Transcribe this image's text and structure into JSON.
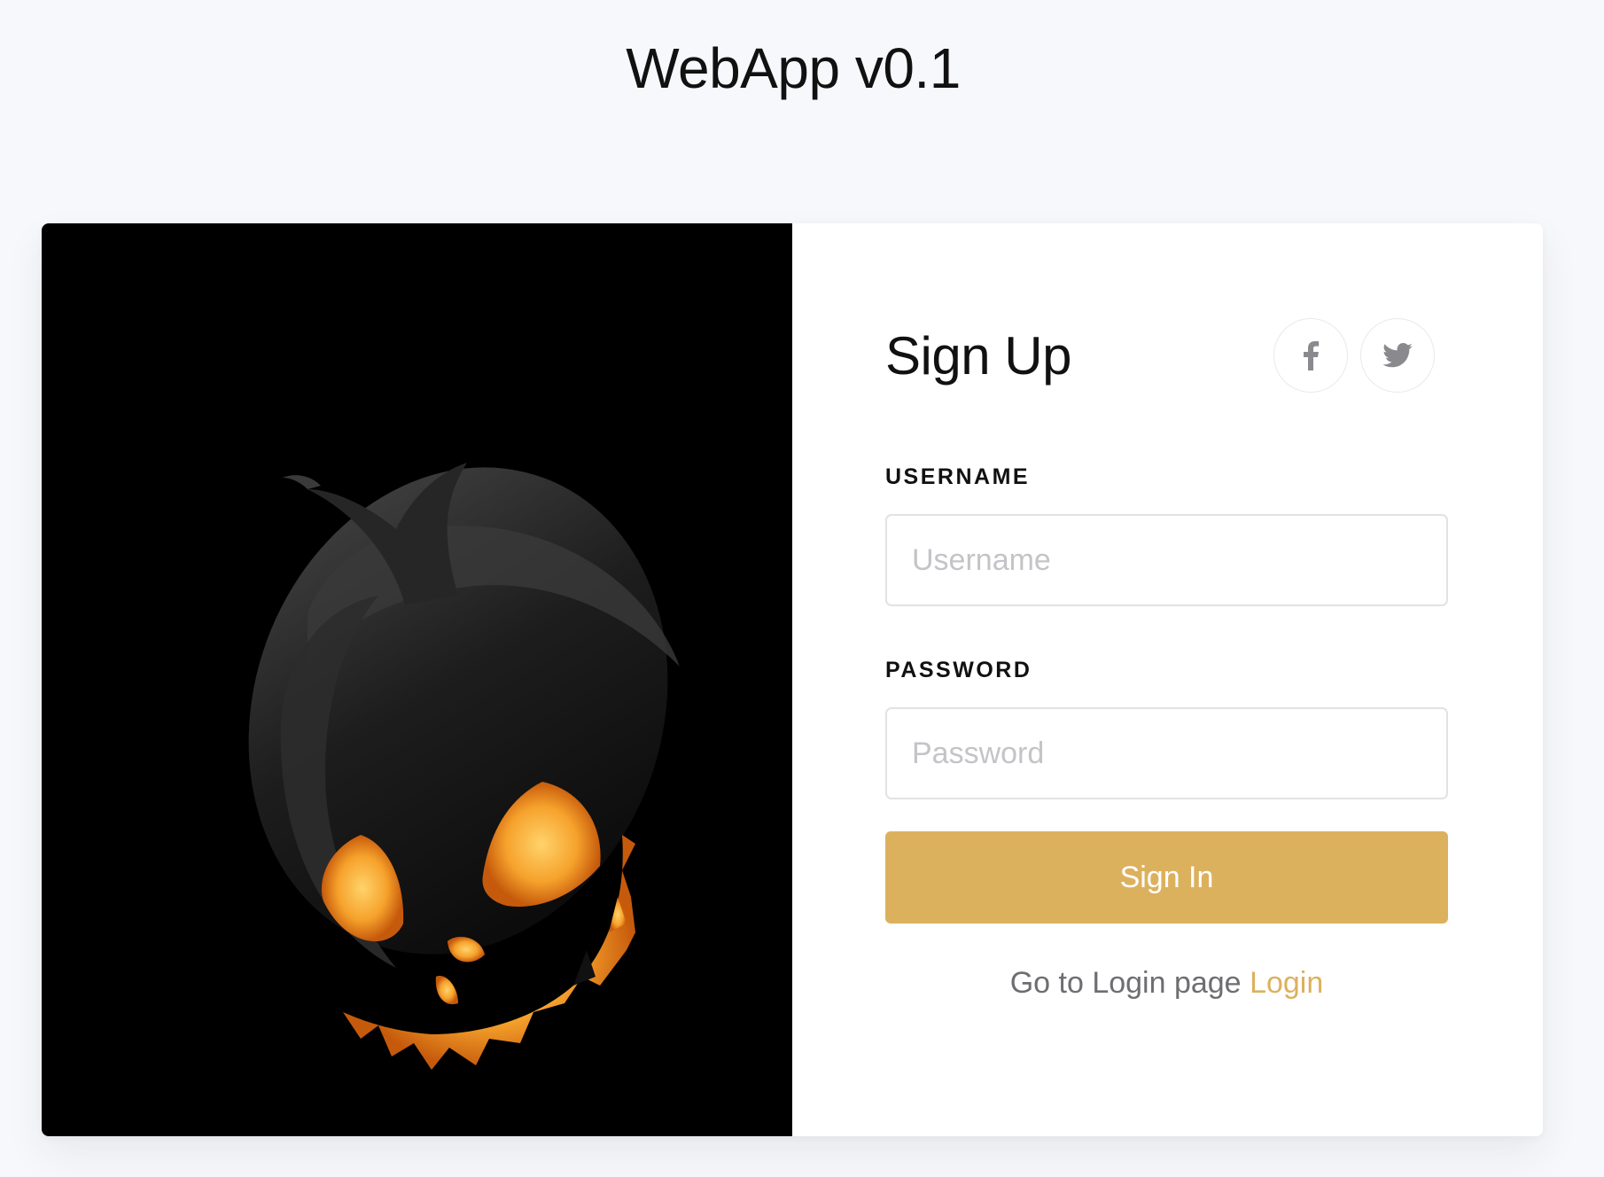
{
  "app": {
    "title": "WebApp v0.1"
  },
  "hero_image": {
    "description_icon": "jack-o-lantern-image"
  },
  "form": {
    "title": "Sign Up",
    "social": [
      {
        "name": "facebook-icon",
        "label": "f"
      },
      {
        "name": "twitter-icon",
        "label": "twitter"
      }
    ],
    "username": {
      "label": "USERNAME",
      "placeholder": "Username",
      "value": ""
    },
    "password": {
      "label": "PASSWORD",
      "placeholder": "Password",
      "value": ""
    },
    "submit_label": "Sign In",
    "alt_text": "Go to Login page",
    "alt_link": "Login"
  },
  "colors": {
    "accent": "#dcb15e",
    "background": "#f7f8fb",
    "image_bg": "#000000",
    "text": "#111111",
    "muted": "#6e6e72"
  }
}
